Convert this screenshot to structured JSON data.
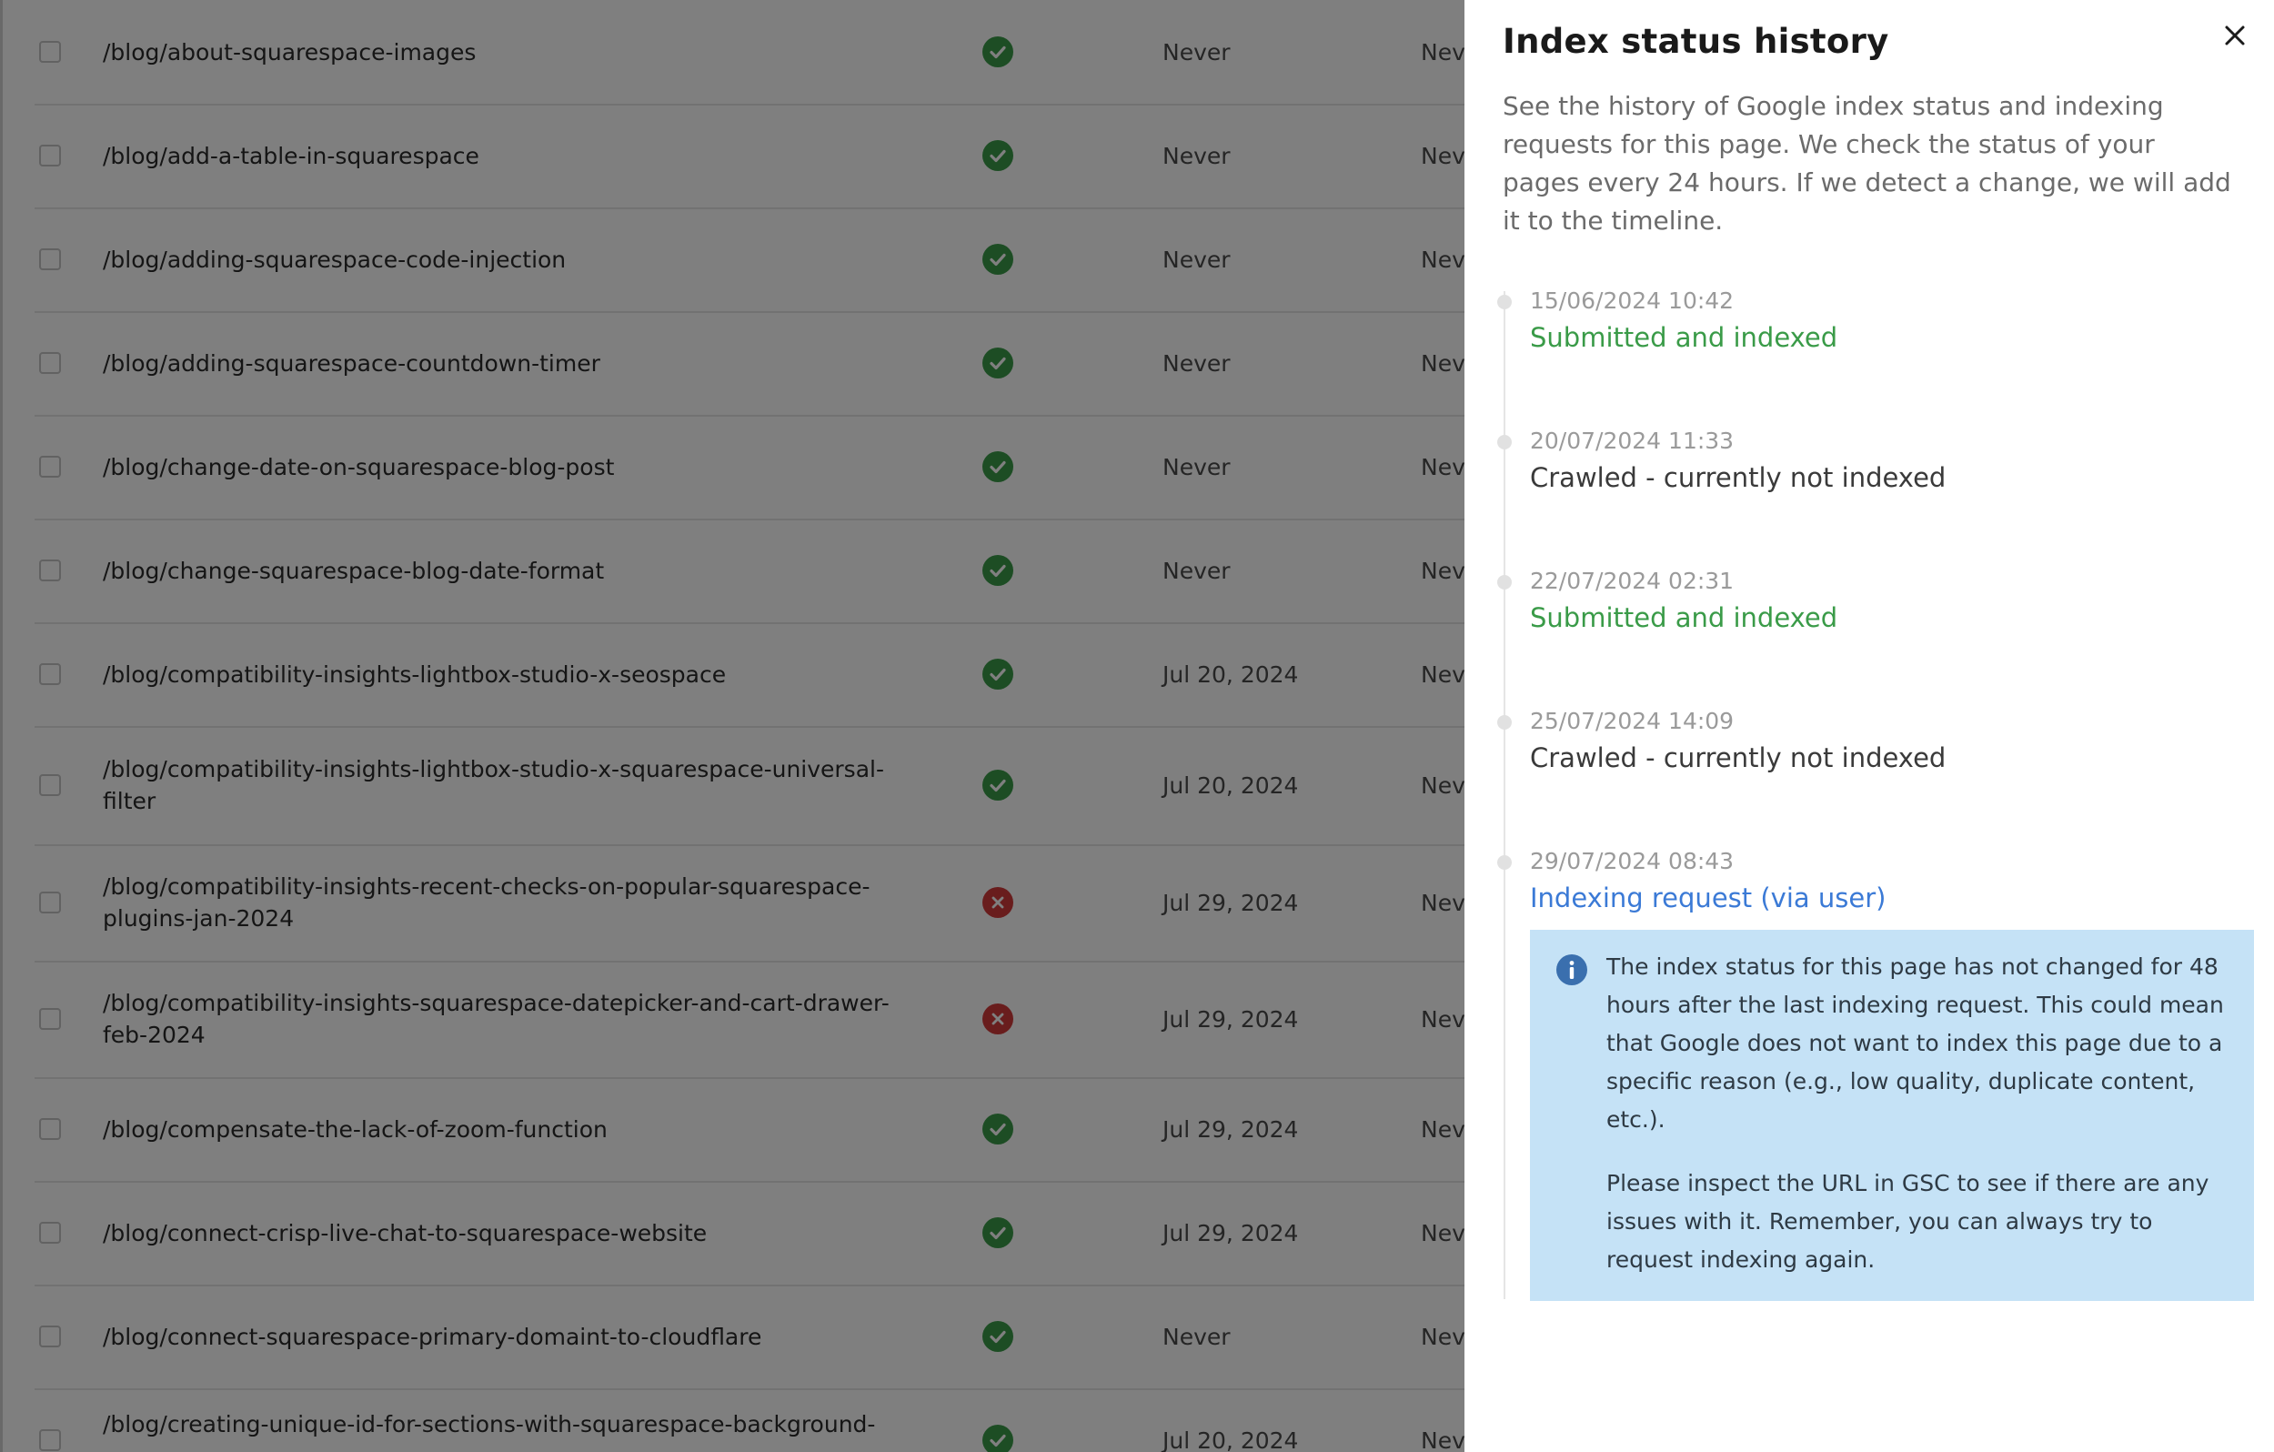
{
  "table": {
    "rows": [
      {
        "url": "/blog/about-squarespace-images",
        "status": "indexed",
        "date": "Never",
        "date2": "Neve"
      },
      {
        "url": "/blog/add-a-table-in-squarespace",
        "status": "indexed",
        "date": "Never",
        "date2": "Neve"
      },
      {
        "url": "/blog/adding-squarespace-code-injection",
        "status": "indexed",
        "date": "Never",
        "date2": "Neve"
      },
      {
        "url": "/blog/adding-squarespace-countdown-timer",
        "status": "indexed",
        "date": "Never",
        "date2": "Neve"
      },
      {
        "url": "/blog/change-date-on-squarespace-blog-post",
        "status": "indexed",
        "date": "Never",
        "date2": "Neve"
      },
      {
        "url": "/blog/change-squarespace-blog-date-format",
        "status": "indexed",
        "date": "Never",
        "date2": "Neve"
      },
      {
        "url": "/blog/compatibility-insights-lightbox-studio-x-seospace",
        "status": "indexed",
        "date": "Jul 20, 2024",
        "date2": "Neve"
      },
      {
        "url": "/blog/compatibility-insights-lightbox-studio-x-squarespace-universal-filter",
        "status": "indexed",
        "date": "Jul 20, 2024",
        "date2": "Neve"
      },
      {
        "url": "/blog/compatibility-insights-recent-checks-on-popular-squarespace-plugins-jan-2024",
        "status": "not-indexed",
        "date": "Jul 29, 2024",
        "date2": "Neve"
      },
      {
        "url": "/blog/compatibility-insights-squarespace-datepicker-and-cart-drawer-feb-2024",
        "status": "not-indexed",
        "date": "Jul 29, 2024",
        "date2": "Neve"
      },
      {
        "url": "/blog/compensate-the-lack-of-zoom-function",
        "status": "indexed",
        "date": "Jul 29, 2024",
        "date2": "Neve"
      },
      {
        "url": "/blog/connect-crisp-live-chat-to-squarespace-website",
        "status": "indexed",
        "date": "Jul 29, 2024",
        "date2": "Neve"
      },
      {
        "url": "/blog/connect-squarespace-primary-domaint-to-cloudflare",
        "status": "indexed",
        "date": "Never",
        "date2": "Neve"
      },
      {
        "url": "/blog/creating-unique-id-for-sections-with-squarespace-background-",
        "status": "indexed",
        "date": "Jul 20, 2024",
        "date2": "Neve"
      }
    ]
  },
  "panel": {
    "title": "Index status history",
    "description": "See the history of Google index status and indexing requests for this page. We check the status of your pages every 24 hours. If we detect a change, we will add it to the timeline.",
    "close_icon": "close-icon",
    "entries": [
      {
        "timestamp": "15/06/2024 10:42",
        "status": "Submitted and indexed",
        "tone": "green"
      },
      {
        "timestamp": "20/07/2024 11:33",
        "status": "Crawled - currently not indexed",
        "tone": "dark"
      },
      {
        "timestamp": "22/07/2024 02:31",
        "status": "Submitted and indexed",
        "tone": "green"
      },
      {
        "timestamp": "25/07/2024 14:09",
        "status": "Crawled - currently not indexed",
        "tone": "dark"
      },
      {
        "timestamp": "29/07/2024 08:43",
        "status": "Indexing request (via user)",
        "tone": "blue"
      }
    ],
    "info": {
      "icon": "info-icon",
      "paragraph1": "The index status for this page has not changed for 48 hours after the last indexing request. This could mean that Google does not want to index this page due to a specific reason (e.g., low quality, duplicate content, etc.).",
      "paragraph2": "Please inspect the URL in GSC to see if there are any issues with it. Remember, you can always try to request indexing again."
    }
  },
  "colors": {
    "green": "#3a9b48",
    "red": "#d33b3b",
    "blue": "#3b7ad6",
    "info_bg": "#c5e2f6"
  }
}
